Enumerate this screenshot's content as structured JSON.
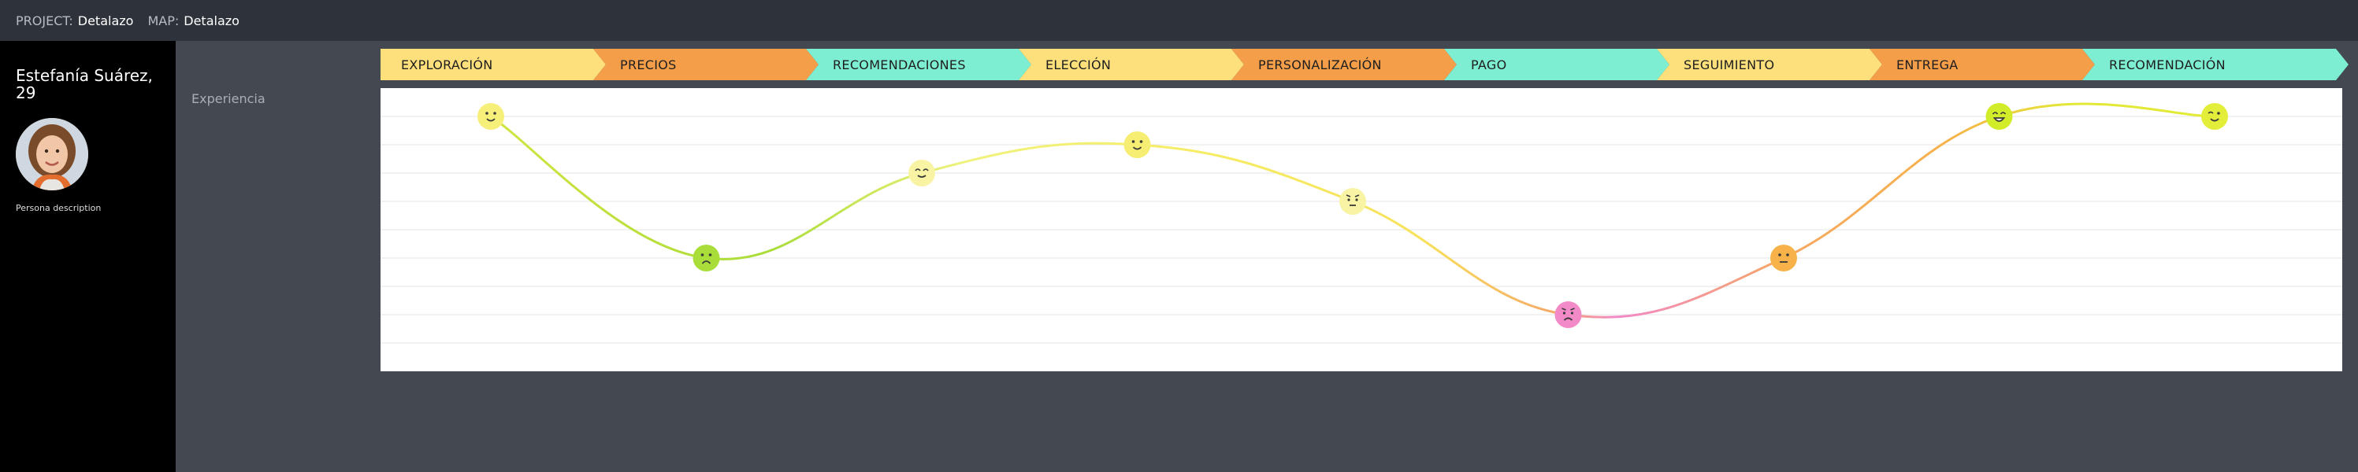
{
  "header": {
    "project_key": "PROJECT:",
    "project_value": "Detalazo",
    "map_key": "MAP:",
    "map_value": "Detalazo"
  },
  "persona": {
    "name": "Estefanía Suárez, 29",
    "description": "Persona description"
  },
  "lane": {
    "label": "Experiencia"
  },
  "stages": [
    {
      "label": "EXPLORACIÓN",
      "color": "#fde07c"
    },
    {
      "label": "PRECIOS",
      "color": "#f49e4a"
    },
    {
      "label": "RECOMENDACIONES",
      "color": "#7eeed2"
    },
    {
      "label": "ELECCIÓN",
      "color": "#fde07c"
    },
    {
      "label": "PERSONALIZACIÓN",
      "color": "#f49e4a"
    },
    {
      "label": "PAGO",
      "color": "#7eeed2"
    },
    {
      "label": "SEGUIMIENTO",
      "color": "#fde07c"
    },
    {
      "label": "ENTREGA",
      "color": "#f49e4a"
    },
    {
      "label": "RECOMENDACIÓN",
      "color": "#7eeed2"
    }
  ],
  "chart_data": {
    "type": "line",
    "categories": [
      "EXPLORACIÓN",
      "PRECIOS",
      "RECOMENDACIONES",
      "ELECCIÓN",
      "PERSONALIZACIÓN",
      "PAGO",
      "SEGUIMIENTO",
      "ENTREGA",
      "RECOMENDACIÓN"
    ],
    "values": [
      4.5,
      -0.5,
      2.5,
      3.5,
      1.5,
      -2.5,
      -0.5,
      4.5,
      4.5
    ],
    "ylim": [
      -4.5,
      5.5
    ],
    "grid": true,
    "point_emotions": [
      "smile",
      "sad",
      "content",
      "smile",
      "unsure",
      "worried",
      "neutral",
      "happy",
      "wink"
    ],
    "point_colors": [
      "#f6f07a",
      "#a9dd3a",
      "#f8f4a4",
      "#f5ee72",
      "#f8f4a4",
      "#f28ac8",
      "#f7b24a",
      "#d2ec2a",
      "#e3ee3a"
    ]
  }
}
